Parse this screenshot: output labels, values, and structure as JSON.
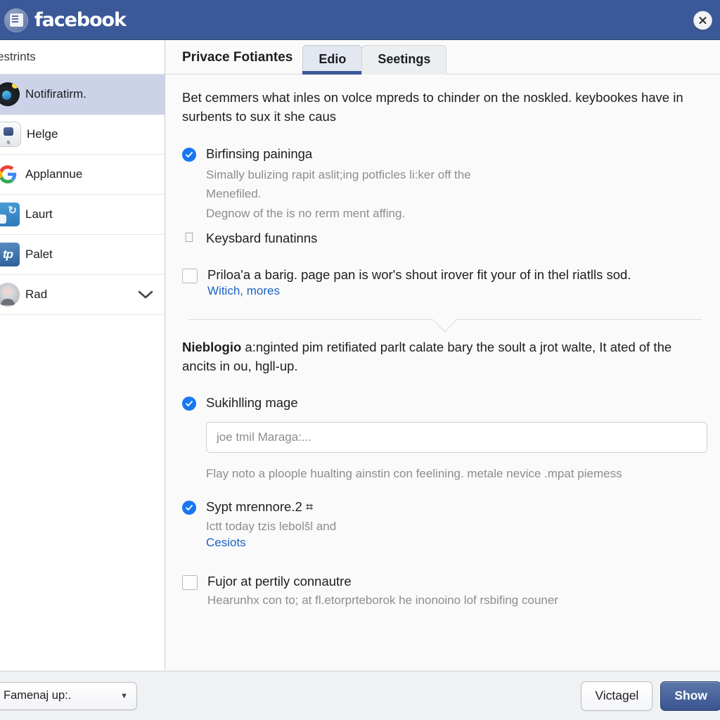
{
  "header": {
    "brand": "facebook",
    "close_label": "×"
  },
  "sidebar": {
    "section_label": "estrints",
    "items": [
      {
        "label": "Notifiratirm.",
        "icon": "notification-avatar-icon",
        "active": true
      },
      {
        "label": "Helge",
        "icon": "lock-badge-icon",
        "active": false
      },
      {
        "label": "Applannue",
        "icon": "google-icon",
        "active": false
      },
      {
        "label": "Laurt",
        "icon": "app-refresh-icon",
        "active": false
      },
      {
        "label": "Palet",
        "icon": "app-tp-icon",
        "active": false
      },
      {
        "label": "Rad",
        "icon": "user-avatar-icon",
        "active": false,
        "chevron": true
      }
    ]
  },
  "tabs": {
    "title": "Privace Fotiantes",
    "items": [
      {
        "label": "Edio",
        "active": true
      },
      {
        "label": "Seetings",
        "active": false
      }
    ]
  },
  "content": {
    "intro": "Bet cemmers what inles on volce mpreds to chinder on the noskled. keybookes have in surbents to sux it she caus",
    "option1": {
      "label": "Birfinsing paininga",
      "sub_line1": "Simally bulizing rapit aslit;ing potficles li:ker off the",
      "sub_line2": "Menefiled.",
      "sub_line3": "Degnow of the is no rerm ment affing.",
      "checked": true
    },
    "keyboard_row": {
      "label": "Keysbard funatinns",
      "icon": "apple-icon"
    },
    "option2": {
      "label": "Priloa'a a barig. page pan is wor's shout irover fit your of in thel riatlls sod.",
      "link": "Witich, mores",
      "checked": false
    },
    "para2_bold": "Nieblogio",
    "para2_rest": " a:nginted pim retifiated parlt calate bary the soult a jrot walte, It ated of the ancits in ou, hgll-up.",
    "option3": {
      "label": "Sukihlling mage",
      "input_placeholder": "joe tmil Maraga:...",
      "hint": "Flay noto a ploople hualting ainstin con feelining. metale nevice .mpat piemess",
      "checked": true
    },
    "option4": {
      "label": "Sypt mrennore.2 ⌗",
      "sub": "Ictt today tzis lebolšl and",
      "link": "Cesiots",
      "checked": true
    },
    "option5": {
      "label": "Fujor at pertily connautre",
      "sub": "Hearunhx con to; at fl.etorprteborok he inonoino lof rsbifing couner",
      "checked": false
    }
  },
  "footer": {
    "select_value": "Famenaj up:.",
    "cancel_label": "Victagel",
    "primary_label": "Show"
  }
}
